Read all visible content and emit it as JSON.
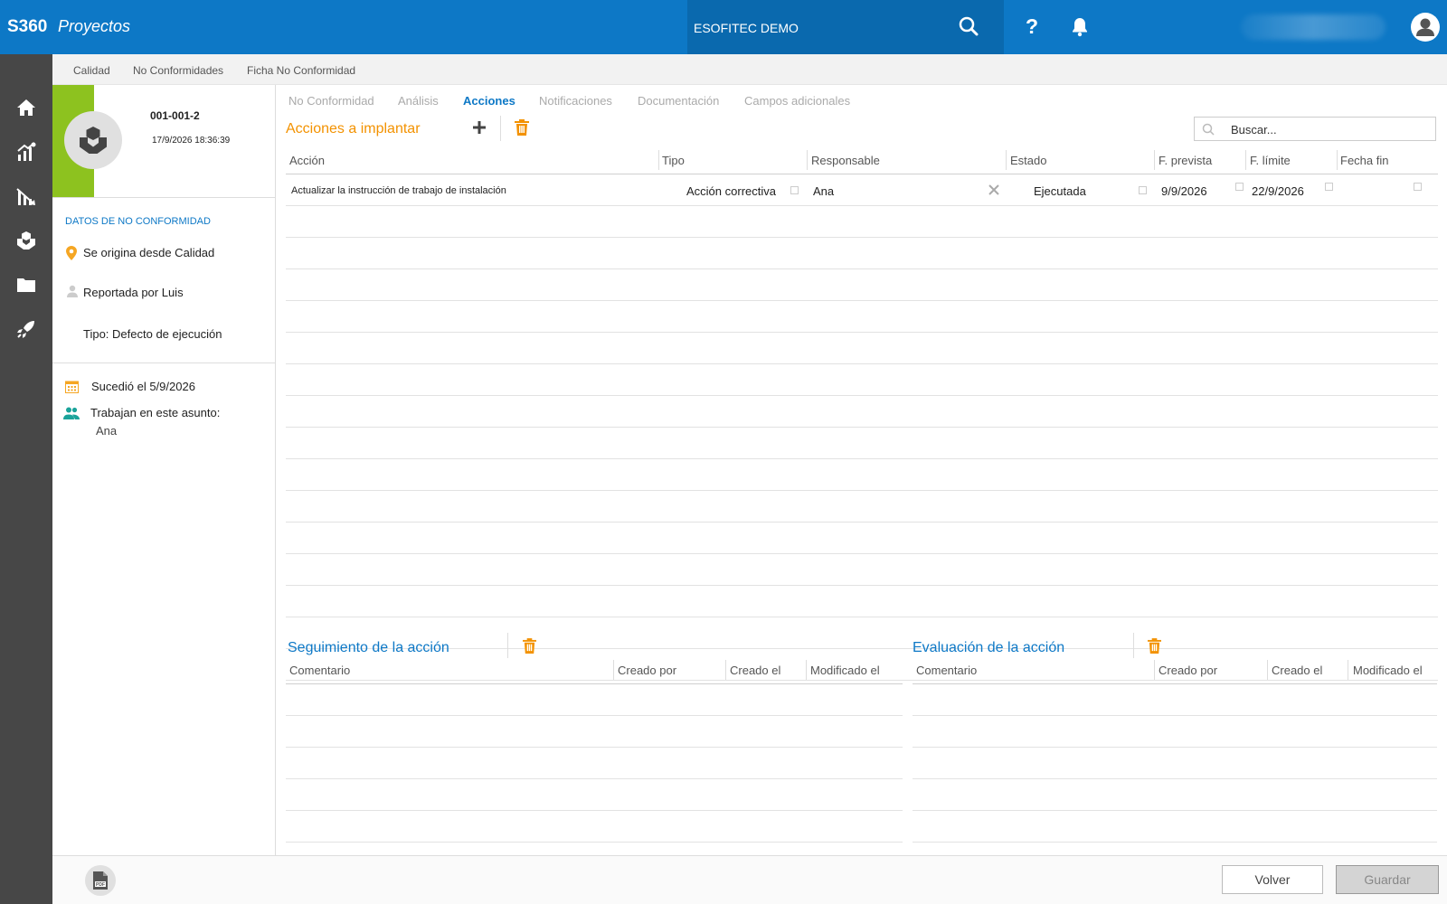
{
  "header": {
    "brand": "S360",
    "app_name": "Proyectos",
    "company": "ESOFITEC DEMO",
    "help_label": "?"
  },
  "nav": {
    "icons": [
      "home-icon",
      "stats-icon",
      "analytics-icon",
      "quality-icon",
      "folder-icon",
      "rocket-icon"
    ]
  },
  "breadcrumb": [
    "Calidad",
    "No Conformidades",
    "Ficha No Conformidad"
  ],
  "record": {
    "code": "001-001-2",
    "datetime": "17/9/2026 18:36:39",
    "section_title": "DATOS DE NO CONFORMIDAD",
    "origin": "Se origina desde Calidad",
    "reported_by": "Reportada por Luis",
    "type": "Tipo: Defecto de ejecución",
    "happened": "Sucedió el 5/9/2026",
    "working_label": "Trabajan en este asunto:",
    "working_person": "Ana"
  },
  "tabs": [
    "No Conformidad",
    "Análisis",
    "Acciones",
    "Notificaciones",
    "Documentación",
    "Campos adicionales"
  ],
  "active_tab": "Acciones",
  "actions": {
    "title": "Acciones a implantar",
    "search_placeholder": "Buscar...",
    "columns": [
      "Acción",
      "Tipo",
      "Responsable",
      "Estado",
      "F. prevista",
      "F. límite",
      "Fecha fin"
    ],
    "rows": [
      {
        "accion": "Actualizar la instrucción de trabajo de instalación",
        "tipo": "Acción correctiva",
        "responsable": "Ana",
        "estado": "Ejecutada",
        "f_prevista": "9/9/2026",
        "f_limite": "22/9/2026",
        "fecha_fin": ""
      }
    ]
  },
  "seguimiento": {
    "title": "Seguimiento de la acción",
    "columns": [
      "Comentario",
      "Creado por",
      "Creado el",
      "Modificado el"
    ]
  },
  "evaluacion": {
    "title": "Evaluación de la acción",
    "columns": [
      "Comentario",
      "Creado por",
      "Creado el",
      "Modificado el"
    ]
  },
  "footer": {
    "back_label": "Volver",
    "save_label": "Guardar"
  },
  "colors": {
    "primary": "#0d78c6",
    "accent_orange": "#f39200",
    "sidebar": "#474747",
    "status_green": "#8dc21f"
  }
}
